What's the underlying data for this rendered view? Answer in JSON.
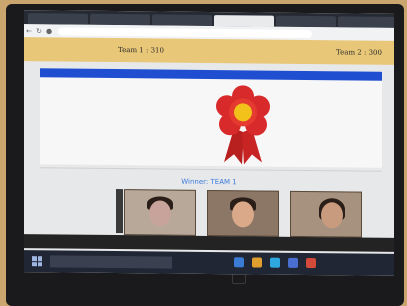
{
  "browser": {
    "tabs": [
      "",
      "",
      "",
      "",
      "",
      ""
    ],
    "url": ""
  },
  "scoreboard": {
    "team1": "Team 1 : 310",
    "team2": "Team 2 : 300",
    "banner": "",
    "winner": "Winner: TEAM 1"
  },
  "meeting_toolbar": [
    "",
    "",
    "",
    "",
    "",
    "",
    "",
    "",
    ""
  ],
  "taskbar": {
    "search_placeholder": "",
    "clock": ""
  },
  "colors": {
    "score_bar": "#e9c778",
    "banner": "#1f4fd0",
    "winner_text": "#3d7bd9",
    "ribbon_petals": "#d82a2a",
    "ribbon_center": "#f2c21a"
  }
}
